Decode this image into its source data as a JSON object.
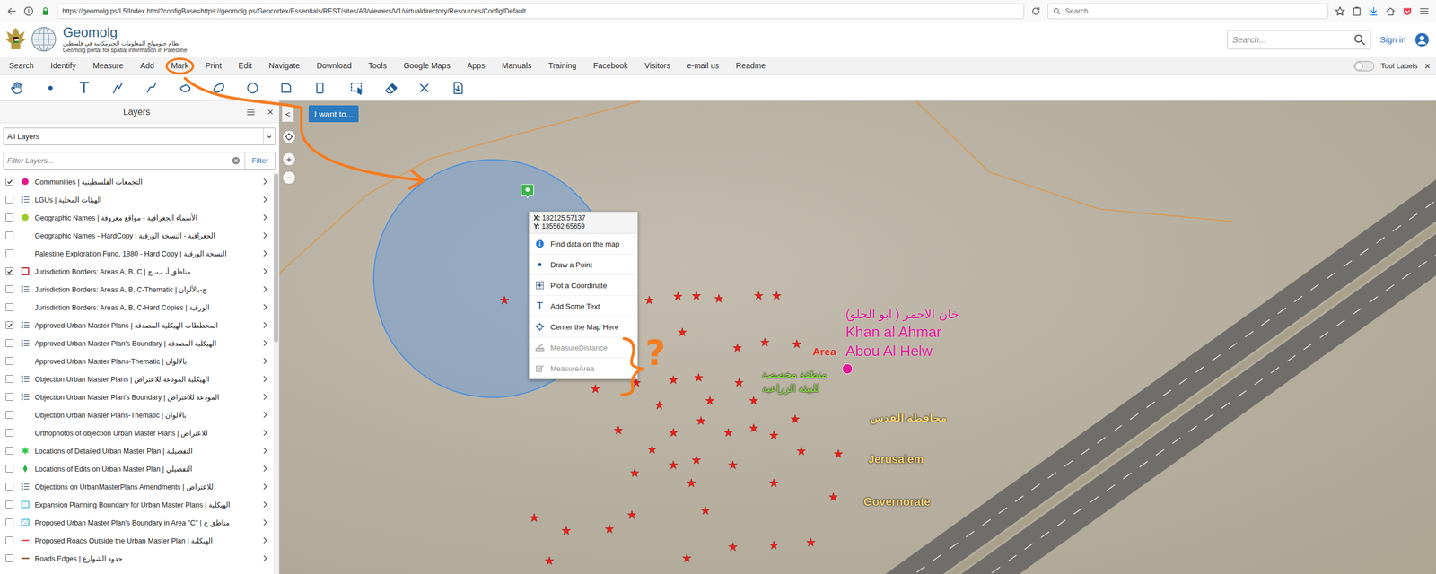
{
  "browser": {
    "url": "https://geomolg.ps/L5/Index.html?configBase=https://geomolg.ps/Geocortex/Essentials/REST/sites/A3/viewers/V1/virtualdirectory/Resources/Config/Default",
    "search_placeholder": "Search"
  },
  "header": {
    "title": "Geomolg",
    "subtitle_ar": "نظام جيومولج للمعلومات الجيومكانية في فلسطين",
    "subtitle_en": "Geomolg portal for spatial information in Palestine",
    "search_placeholder": "Search...",
    "sign_in": "Sign in"
  },
  "menu": {
    "items": [
      {
        "label": "Search",
        "circled": false
      },
      {
        "label": "Identify",
        "circled": false
      },
      {
        "label": "Measure",
        "circled": false
      },
      {
        "label": "Add",
        "circled": false
      },
      {
        "label": "Mark",
        "circled": true
      },
      {
        "label": "Print",
        "circled": false
      },
      {
        "label": "Edit",
        "circled": false
      },
      {
        "label": "Navigate",
        "circled": false
      },
      {
        "label": "Download",
        "circled": false
      },
      {
        "label": "Tools",
        "circled": false
      },
      {
        "label": "Google Maps",
        "circled": false
      },
      {
        "label": "Apps",
        "circled": false
      },
      {
        "label": "Manuals",
        "circled": false
      },
      {
        "label": "Training",
        "circled": false
      },
      {
        "label": "Facebook",
        "circled": false
      },
      {
        "label": "Visitors",
        "circled": false
      },
      {
        "label": "e-mail us",
        "circled": false
      },
      {
        "label": "Readme",
        "circled": false
      }
    ],
    "tool_labels": {
      "label": "Tool Labels",
      "on": false
    },
    "close": "×"
  },
  "tools": [
    {
      "kind": "pan"
    },
    {
      "kind": "point"
    },
    {
      "kind": "text",
      "glyph": "T"
    },
    {
      "kind": "line"
    },
    {
      "kind": "freehand-line"
    },
    {
      "kind": "freehand-area"
    },
    {
      "kind": "ellipse"
    },
    {
      "kind": "circle"
    },
    {
      "kind": "square"
    },
    {
      "kind": "rectangle"
    },
    {
      "kind": "select"
    },
    {
      "kind": "erase"
    },
    {
      "kind": "clear"
    },
    {
      "kind": "export"
    }
  ],
  "layers_panel": {
    "title": "Layers",
    "close": "×",
    "filter_select": "All Layers",
    "filter_placeholder": "Filter Layers...",
    "filter_button": "Filter",
    "layers": [
      {
        "label": "Communities | التجمعات الفلسطينية",
        "checked": true,
        "kind": "dot",
        "color": "#e5168d"
      },
      {
        "label": "LGUs | الهيئات المحلية",
        "checked": false,
        "kind": "list"
      },
      {
        "label": "Geographic Names | الأسماء الجغرافية - مواقع معروفة",
        "checked": false,
        "kind": "dot",
        "color": "#9ccc2c"
      },
      {
        "label": "Geographic Names - HardCopy | الجغرافية - النسخة الورقية",
        "checked": false,
        "kind": "none"
      },
      {
        "label": "Palestine Exploration Fund, 1880 - Hard Copy | النسخة الورقية",
        "checked": false,
        "kind": "none"
      },
      {
        "label": "Jurisdiction Borders: Areas A, B, C | مناطق أ، ب، ج",
        "checked": true,
        "kind": "square",
        "color": "#c0282d"
      },
      {
        "label": "Jurisdiction Borders: Areas A, B, C-Thematic | ج-بالألوان",
        "checked": false,
        "kind": "list"
      },
      {
        "label": "Jurisdiction Borders: Areas A, B, C-Hard Copies | الورقية",
        "checked": false,
        "kind": "none"
      },
      {
        "label": "Approved Urban Master Plans | المخططات الهيكلية المصدقة",
        "checked": true,
        "kind": "list"
      },
      {
        "label": "Approved Urban Master Plan's Boundary | الهيكلية المصدقة",
        "checked": false,
        "kind": "list"
      },
      {
        "label": "Approved Urban Master Plans-Thematic | بالالوان",
        "checked": false,
        "kind": "none"
      },
      {
        "label": "Objection Urban Master Plans | الهيكلية المودعة للاعتراض",
        "checked": false,
        "kind": "list"
      },
      {
        "label": "Objection Urban Master Plan's Boundary | المودعة للاعتراض",
        "checked": false,
        "kind": "list"
      },
      {
        "label": "Objection Urban Master Plans-Thematic | بالالوان",
        "checked": false,
        "kind": "none"
      },
      {
        "label": "Orthophotos of objection Urban Master Plans | للاعتراض",
        "checked": false,
        "kind": "none"
      },
      {
        "label": "Locations of Detailed Urban Master Plan | التفصيلية",
        "checked": false,
        "kind": "star",
        "color": "#27c93f"
      },
      {
        "label": "Locations of Edits on Urban Master Plan | التفصيلي",
        "checked": false,
        "kind": "diamond",
        "color": "#27b34a"
      },
      {
        "label": "Objections on UrbanMasterPlans Amendments | للاعتراض",
        "checked": false,
        "kind": "list"
      },
      {
        "label": "Expansion Planning Boundary for Urban Master Plans | الهيكلية",
        "checked": false,
        "kind": "box",
        "color": "#3fb6d8"
      },
      {
        "label": "Proposed Urban Master Plan's Boundary in Area \"C\" | مناطق ج",
        "checked": false,
        "kind": "hatch",
        "color": "#3fb6d8"
      },
      {
        "label": "Proposed Roads Outside the Urban Master Plan | الهيكلية",
        "checked": false,
        "kind": "line",
        "color": "#d9534f"
      },
      {
        "label": "Roads Edges | حدود الشوارع",
        "checked": false,
        "kind": "line",
        "color": "#8b5a2b"
      }
    ]
  },
  "map": {
    "collapse": "<",
    "i_want_to": "I want to...",
    "zoom_in": "+",
    "zoom_out": "−",
    "labels": [
      {
        "text": "خان الاحمر ( ابو الحلو)",
        "color": "#e0179a"
      },
      {
        "text": "Khan al Ahmar",
        "color": "#e0179a"
      },
      {
        "text": "Abou Al Helw",
        "color": "#e0179a"
      },
      {
        "text": "Area",
        "color": "#e52b23"
      },
      {
        "text": "منطقة مخصصة",
        "color": "#8ee04e"
      },
      {
        "text": "للبيئة الزراعية",
        "color": "#8ee04e"
      },
      {
        "text": "محافظة القدس",
        "color": "#f4d37c"
      },
      {
        "text": "Jerusalem",
        "color": "#f4d37c"
      },
      {
        "text": "Governorate",
        "color": "#f4d37c"
      }
    ],
    "context_menu": {
      "coords": [
        {
          "axis": "X:",
          "value": "182125.57137"
        },
        {
          "axis": "Y:",
          "value": "135562.65659"
        }
      ],
      "items": [
        {
          "label": "Find data on the map",
          "kind": "info",
          "disabled": false
        },
        {
          "label": "Draw a Point",
          "kind": "point",
          "disabled": false
        },
        {
          "label": "Plot a Coordinate",
          "kind": "plot",
          "disabled": false
        },
        {
          "label": "Add Some Text",
          "kind": "text",
          "glyph": "T",
          "disabled": false
        },
        {
          "label": "Center the Map Here",
          "kind": "center",
          "disabled": false
        },
        {
          "label": "MeasureDistance",
          "kind": "distance",
          "disabled": true
        },
        {
          "label": "MeasureArea",
          "kind": "area",
          "disabled": true
        }
      ]
    }
  },
  "annotation": {
    "mark": "?"
  }
}
